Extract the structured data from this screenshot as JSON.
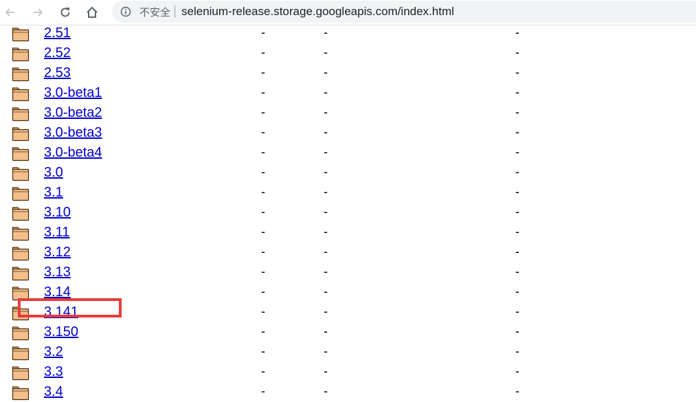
{
  "browser": {
    "security_label": "不安全",
    "url": "selenium-release.storage.googleapis.com/index.html"
  },
  "listing": {
    "entries": [
      {
        "name": "2.51",
        "modified": "-",
        "size": "-",
        "etag": "-"
      },
      {
        "name": "2.52",
        "modified": "-",
        "size": "-",
        "etag": "-"
      },
      {
        "name": "2.53",
        "modified": "-",
        "size": "-",
        "etag": "-"
      },
      {
        "name": "3.0-beta1",
        "modified": "-",
        "size": "-",
        "etag": "-"
      },
      {
        "name": "3.0-beta2",
        "modified": "-",
        "size": "-",
        "etag": "-"
      },
      {
        "name": "3.0-beta3",
        "modified": "-",
        "size": "-",
        "etag": "-"
      },
      {
        "name": "3.0-beta4",
        "modified": "-",
        "size": "-",
        "etag": "-"
      },
      {
        "name": "3.0",
        "modified": "-",
        "size": "-",
        "etag": "-"
      },
      {
        "name": "3.1",
        "modified": "-",
        "size": "-",
        "etag": "-"
      },
      {
        "name": "3.10",
        "modified": "-",
        "size": "-",
        "etag": "-"
      },
      {
        "name": "3.11",
        "modified": "-",
        "size": "-",
        "etag": "-"
      },
      {
        "name": "3.12",
        "modified": "-",
        "size": "-",
        "etag": "-"
      },
      {
        "name": "3.13",
        "modified": "-",
        "size": "-",
        "etag": "-"
      },
      {
        "name": "3.14",
        "modified": "-",
        "size": "-",
        "etag": "-"
      },
      {
        "name": "3.141",
        "modified": "-",
        "size": "-",
        "etag": "-"
      },
      {
        "name": "3.150",
        "modified": "-",
        "size": "-",
        "etag": "-"
      },
      {
        "name": "3.2",
        "modified": "-",
        "size": "-",
        "etag": "-"
      },
      {
        "name": "3.3",
        "modified": "-",
        "size": "-",
        "etag": "-"
      },
      {
        "name": "3.4",
        "modified": "-",
        "size": "-",
        "etag": "-"
      }
    ]
  },
  "colors": {
    "link": "#0000cc",
    "highlight": "#e83b3b",
    "folder_fill": "#f3c08c",
    "folder_stroke": "#4a2a0a"
  }
}
